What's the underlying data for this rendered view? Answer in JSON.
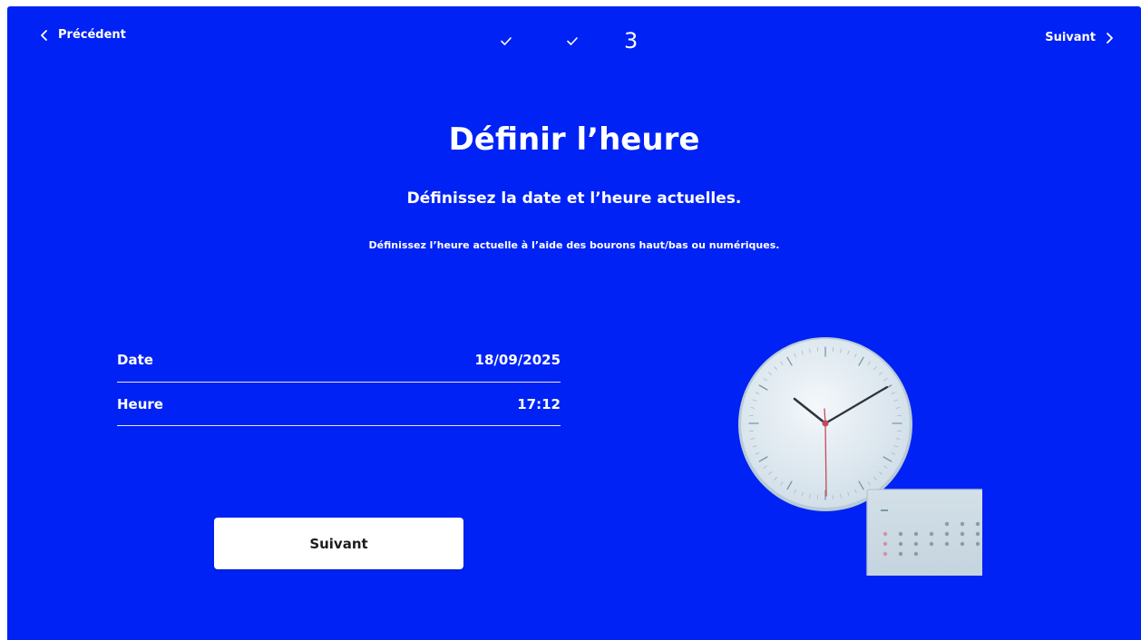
{
  "nav": {
    "prev_label": "Précédent",
    "next_label": "Suivant"
  },
  "steps": {
    "current": "3",
    "completed": 2
  },
  "header": {
    "title": "Définir l’heure",
    "subtitle": "Définissez la date et l’heure actuelles.",
    "hint": "Définissez l’heure actuelle à l’aide des bourons haut/bas ou numériques."
  },
  "fields": {
    "date": {
      "label": "Date",
      "value": "18/09/2025"
    },
    "time": {
      "label": "Heure",
      "value": "17:12"
    }
  },
  "footer": {
    "next_button": "Suivant"
  },
  "colors": {
    "background": "#0022f5",
    "text": "#ffffff",
    "button_bg": "#ffffff",
    "button_text": "#1d1d1d"
  },
  "icons": {
    "prev": "chevron-left-icon",
    "next": "chevron-right-icon",
    "step_done": "check-icon",
    "illustration": "clock-calendar-illustration"
  }
}
